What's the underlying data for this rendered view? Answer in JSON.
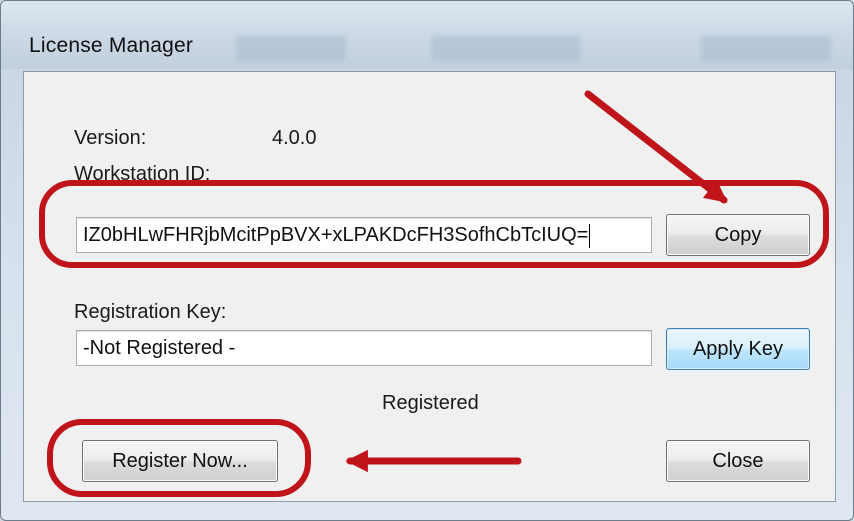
{
  "window": {
    "title": "License Manager"
  },
  "version": {
    "label": "Version:",
    "value": "4.0.0"
  },
  "workstation": {
    "label": "Workstation  ID:",
    "value": "IZ0bHLwFHRjbMcitPpBVX+xLPAKDcFH3SofhCbTcIUQ=",
    "copy_label": "Copy"
  },
  "registration": {
    "label": "Registration Key:",
    "value": "-Not Registered -",
    "apply_label": "Apply Key"
  },
  "status": {
    "text": "Registered"
  },
  "buttons": {
    "register_now": "Register Now...",
    "close": "Close"
  },
  "annotations": {
    "color": "#c0141b"
  }
}
